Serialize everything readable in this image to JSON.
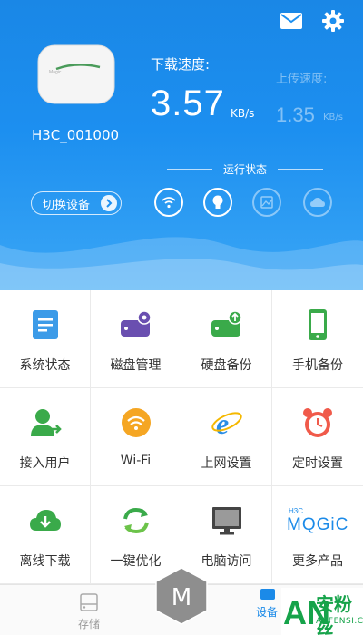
{
  "header": {
    "device_name": "H3C_001000",
    "download_label": "下载速度:",
    "download_value": "3.57",
    "download_unit": "KB/s",
    "upload_label": "上传速度:",
    "upload_value": "1.35",
    "upload_unit": "KB/s",
    "status_title": "运行状态",
    "switch_device": "切换设备",
    "icons": [
      "mail-icon",
      "gear-icon",
      "wifi-icon",
      "lightbulb-icon",
      "photo-icon",
      "cloud-icon"
    ]
  },
  "grid": {
    "items": [
      {
        "label": "系统状态",
        "icon": "document-icon"
      },
      {
        "label": "磁盘管理",
        "icon": "disk-settings-icon"
      },
      {
        "label": "硬盘备份",
        "icon": "disk-upload-icon"
      },
      {
        "label": "手机备份",
        "icon": "phone-icon"
      },
      {
        "label": "接入用户",
        "icon": "user-icon"
      },
      {
        "label": "Wi-Fi",
        "icon": "wifi-icon"
      },
      {
        "label": "上网设置",
        "icon": "ie-browser-icon"
      },
      {
        "label": "定时设置",
        "icon": "alarm-clock-icon"
      },
      {
        "label": "离线下载",
        "icon": "cloud-download-icon"
      },
      {
        "label": "一键优化",
        "icon": "refresh-icon"
      },
      {
        "label": "电脑访问",
        "icon": "monitor-icon"
      },
      {
        "label": "更多产品",
        "icon": "h3c-magic-logo"
      }
    ],
    "magic_logo_top": "H3C",
    "magic_logo_text": "MQGiC"
  },
  "nav": {
    "storage_label": "存储",
    "center_letter": "M",
    "device_label": "设备"
  },
  "watermark": {
    "big": "安粉丝",
    "small": "ANFENSI.COM",
    "logo": "AN"
  },
  "colors": {
    "header_blue": "#1c8ff0",
    "green": "#3aaa4a",
    "purple": "#6a4fb0",
    "orange": "#f5a623",
    "red": "#f05a4a"
  }
}
